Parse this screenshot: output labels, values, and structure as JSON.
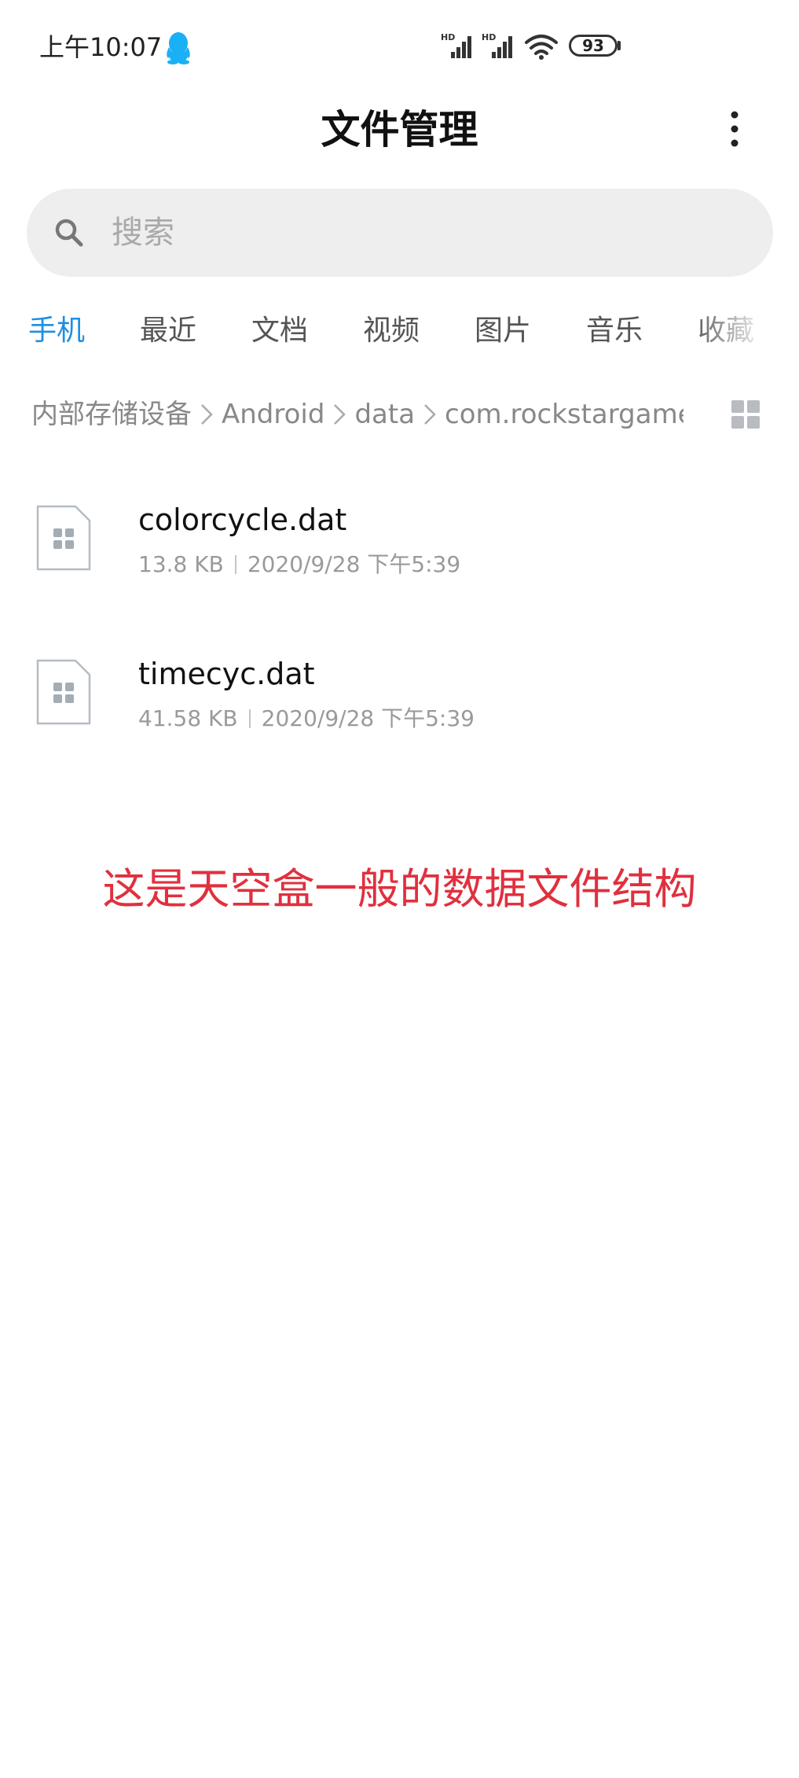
{
  "status_bar": {
    "time": "上午10:07",
    "signal_1_label": "HD",
    "signal_2_label": "HD",
    "battery_level": "93",
    "icons": [
      "qq-icon",
      "signal-icon",
      "signal-icon",
      "wifi-icon",
      "battery-icon"
    ]
  },
  "header": {
    "title": "文件管理",
    "more_icon": "more-vertical-icon"
  },
  "search": {
    "placeholder": "搜索",
    "icon": "search-icon"
  },
  "tabs": [
    {
      "label": "手机",
      "active": true
    },
    {
      "label": "最近",
      "active": false
    },
    {
      "label": "文档",
      "active": false
    },
    {
      "label": "视频",
      "active": false
    },
    {
      "label": "图片",
      "active": false
    },
    {
      "label": "音乐",
      "active": false
    },
    {
      "label": "收藏",
      "active": false
    }
  ],
  "breadcrumb": {
    "items": [
      "内部存储设备",
      "Android",
      "data",
      "com.rockstargames"
    ],
    "view_toggle_icon": "grid-view-icon"
  },
  "files": [
    {
      "name": "colorcycle.dat",
      "size": "13.8 KB",
      "date": "2020/9/28 下午5:39"
    },
    {
      "name": "timecyc.dat",
      "size": "41.58 KB",
      "date": "2020/9/28 下午5:39"
    }
  ],
  "overlay": {
    "caption": "这是天空盒一般的数据文件结构"
  },
  "colors": {
    "accent": "#1e8fe0",
    "caption": "#e0303e",
    "search_bg": "#eeeeee",
    "qq_blue": "#1ab0f5"
  }
}
